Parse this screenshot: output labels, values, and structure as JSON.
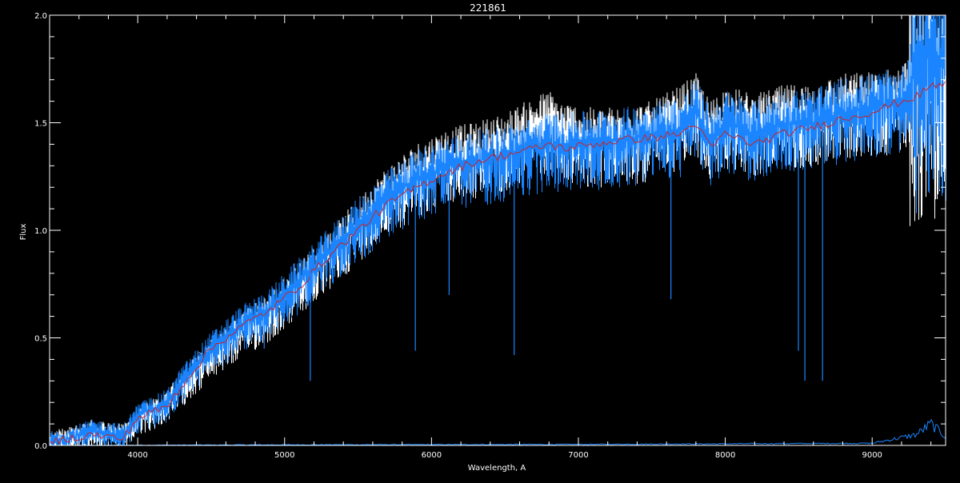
{
  "chart_data": {
    "type": "line",
    "title": "221861",
    "xlabel": "Wavelength, A",
    "ylabel": "Flux",
    "xlim": [
      3400,
      9500
    ],
    "ylim": [
      0.0,
      2.0
    ],
    "x_ticks": [
      4000,
      5000,
      6000,
      7000,
      8000,
      9000
    ],
    "x_tick_labels": [
      "4000",
      "5000",
      "6000",
      "7000",
      "8000",
      "9000"
    ],
    "y_ticks": [
      0.0,
      0.5,
      1.0,
      1.5,
      2.0
    ],
    "y_tick_labels": [
      "0.0",
      "0.5",
      "1.0",
      "1.5",
      "2.0"
    ],
    "grid": false,
    "background": "#000000",
    "axis_color": "#ffffff",
    "series": [
      {
        "color": "#ffffff",
        "style": "noisy-spectrum",
        "x": [
          3400,
          3500,
          3700,
          3900,
          4000,
          4200,
          4300,
          4500,
          4700,
          4900,
          5100,
          5300,
          5500,
          5700,
          5900,
          6100,
          6300,
          6500,
          6700,
          6800,
          6900,
          7100,
          7300,
          7500,
          7700,
          7800,
          7900,
          8000,
          8200,
          8400,
          8600,
          8800,
          9000,
          9200,
          9300,
          9400,
          9500
        ],
        "y": [
          0.02,
          0.03,
          0.07,
          0.05,
          0.12,
          0.2,
          0.28,
          0.42,
          0.53,
          0.62,
          0.75,
          0.88,
          1.03,
          1.17,
          1.27,
          1.33,
          1.36,
          1.4,
          1.47,
          1.5,
          1.45,
          1.42,
          1.43,
          1.45,
          1.52,
          1.57,
          1.45,
          1.52,
          1.48,
          1.52,
          1.53,
          1.57,
          1.58,
          1.6,
          1.7,
          1.75,
          1.68
        ]
      },
      {
        "color": "#1a85ff",
        "style": "noisy-spectrum",
        "x": [
          3400,
          3500,
          3700,
          3900,
          4000,
          4200,
          4300,
          4500,
          4700,
          4900,
          5100,
          5300,
          5500,
          5700,
          5900,
          6100,
          6300,
          6500,
          6700,
          6800,
          6900,
          7100,
          7300,
          7500,
          7700,
          7800,
          7900,
          8000,
          8200,
          8400,
          8600,
          8800,
          9000,
          9200,
          9300,
          9400,
          9500
        ],
        "y": [
          0.02,
          0.03,
          0.07,
          0.05,
          0.14,
          0.2,
          0.3,
          0.45,
          0.56,
          0.64,
          0.77,
          0.9,
          1.03,
          1.15,
          1.24,
          1.3,
          1.32,
          1.35,
          1.38,
          1.4,
          1.4,
          1.41,
          1.42,
          1.45,
          1.47,
          1.55,
          1.42,
          1.5,
          1.45,
          1.5,
          1.5,
          1.55,
          1.57,
          1.6,
          1.75,
          1.85,
          1.75
        ]
      },
      {
        "color": "#cc2222",
        "style": "smooth",
        "x": [
          3400,
          3500,
          3700,
          3900,
          4000,
          4200,
          4300,
          4500,
          4700,
          4900,
          5100,
          5300,
          5500,
          5700,
          5900,
          6100,
          6300,
          6500,
          6700,
          6800,
          6900,
          7100,
          7300,
          7500,
          7700,
          7800,
          7900,
          8000,
          8200,
          8400,
          8600,
          8800,
          9000,
          9200,
          9300,
          9400,
          9500
        ],
        "y": [
          0.01,
          0.03,
          0.05,
          0.03,
          0.13,
          0.18,
          0.28,
          0.45,
          0.55,
          0.63,
          0.74,
          0.88,
          1.0,
          1.12,
          1.2,
          1.27,
          1.32,
          1.35,
          1.38,
          1.4,
          1.38,
          1.4,
          1.42,
          1.43,
          1.45,
          1.5,
          1.38,
          1.45,
          1.4,
          1.45,
          1.48,
          1.52,
          1.55,
          1.6,
          1.62,
          1.67,
          1.68
        ]
      }
    ],
    "absorption_lines": [
      {
        "x": 3933,
        "y": 0.05
      },
      {
        "x": 4340,
        "y": 0.3
      },
      {
        "x": 4861,
        "y": 0.45
      },
      {
        "x": 5175,
        "y": 0.3
      },
      {
        "x": 5890,
        "y": 0.44
      },
      {
        "x": 6120,
        "y": 0.7
      },
      {
        "x": 6563,
        "y": 0.42
      },
      {
        "x": 7630,
        "y": 0.68
      },
      {
        "x": 8498,
        "y": 0.44
      },
      {
        "x": 8542,
        "y": 0.3
      },
      {
        "x": 8662,
        "y": 0.3
      }
    ],
    "noise_floor": {
      "color": "#1a85ff",
      "x": [
        3400,
        5000,
        7000,
        9000,
        9300,
        9400,
        9500
      ],
      "y": [
        0.0,
        0.003,
        0.005,
        0.01,
        0.05,
        0.1,
        0.04
      ]
    }
  }
}
